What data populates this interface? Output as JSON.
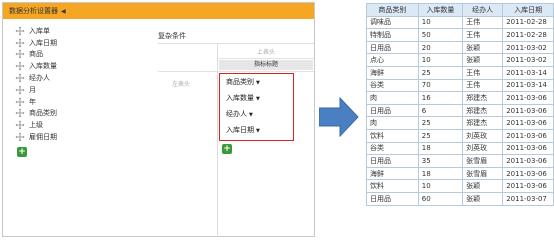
{
  "designer": {
    "title": "数据分析设置器",
    "fields": [
      "入库单",
      "入库日期",
      "商品",
      "入库数量",
      "经办人",
      "月",
      "年",
      "商品类别",
      "上级",
      "雇佣日期"
    ],
    "condition_label": "复杂条件",
    "column_placeholder": "上表头",
    "index_title": "指标标题",
    "row_placeholder": "左表头",
    "row_items": [
      "商品类别",
      "入库数量",
      "经办人",
      "入库日期"
    ]
  },
  "table": {
    "headers": [
      "商品类别",
      "入库数量",
      "经办人",
      "入库日期"
    ],
    "rows": [
      [
        "调味品",
        "10",
        "王伟",
        "2011-02-28"
      ],
      [
        "特制品",
        "50",
        "王伟",
        "2011-02-28"
      ],
      [
        "日用品",
        "20",
        "张颖",
        "2011-03-02"
      ],
      [
        "点心",
        "10",
        "张颖",
        "2011-03-02"
      ],
      [
        "海鲜",
        "25",
        "王伟",
        "2011-03-14"
      ],
      [
        "谷类",
        "70",
        "王伟",
        "2011-03-14"
      ],
      [
        "肉",
        "16",
        "郑建杰",
        "2011-03-06"
      ],
      [
        "日用品",
        "6",
        "郑建杰",
        "2011-03-06"
      ],
      [
        "肉",
        "25",
        "郑建杰",
        "2011-03-06"
      ],
      [
        "饮料",
        "25",
        "刘英玫",
        "2011-03-06"
      ],
      [
        "谷类",
        "18",
        "刘英玫",
        "2011-03-06"
      ],
      [
        "日用品",
        "35",
        "张雪眉",
        "2011-03-06"
      ],
      [
        "海鲜",
        "18",
        "张雪眉",
        "2011-03-06"
      ],
      [
        "饮料",
        "10",
        "张颖",
        "2011-03-06"
      ],
      [
        "日用品",
        "60",
        "张颖",
        "2011-03-07"
      ]
    ]
  },
  "colors": {
    "header_orange": "#f5a623",
    "highlight_red": "#d9261c",
    "arrow_blue": "#4a7fc1",
    "table_header": "#dbe8f6",
    "add_green": "#3a9a3a"
  }
}
